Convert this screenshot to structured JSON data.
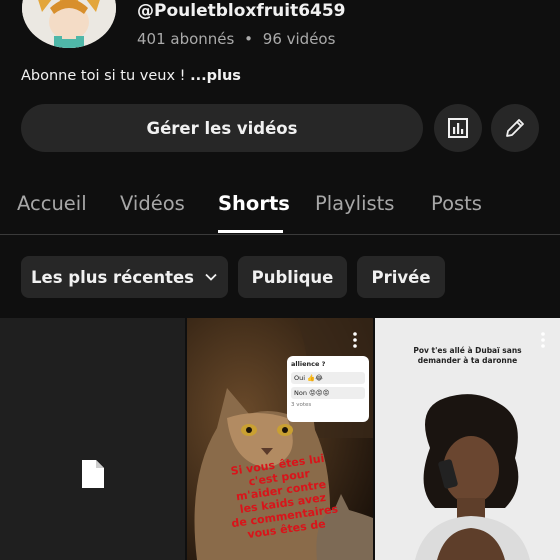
{
  "channel": {
    "handle": "@Pouletbloxfruit6459",
    "subscribers": "401 abonnés",
    "separator": "•",
    "videos": "96 vidéos",
    "bio": "Abonne toi si tu veux !",
    "bio_more": "...plus"
  },
  "actions": {
    "manage_label": "Gérer les vidéos",
    "analytics_icon": "bar-chart-icon",
    "edit_icon": "pencil-icon"
  },
  "tabs": [
    {
      "label": "Accueil",
      "active": false
    },
    {
      "label": "Vidéos",
      "active": false
    },
    {
      "label": "Shorts",
      "active": true
    },
    {
      "label": "Playlists",
      "active": false
    },
    {
      "label": "Posts",
      "active": false
    }
  ],
  "filters": {
    "sort_label": "Les plus récentes",
    "public_label": "Publique",
    "private_label": "Privée"
  },
  "shorts": [
    {
      "kind": "placeholder",
      "icon": "file-icon"
    },
    {
      "kind": "cat",
      "poll_title": "allience ?",
      "poll_options": [
        "Oui 👍😂",
        "Non 😡😡😡"
      ],
      "poll_footer": "3 votes",
      "caption_lines": [
        "Si vous êtes lui",
        "c'est pour",
        "m'aider contre",
        "les kaids avez",
        "de commentaires",
        "vous êtes de"
      ]
    },
    {
      "kind": "dubai",
      "caption_lines": [
        "Pov t'es allé à Dubaï sans",
        "demander à ta daronne"
      ]
    }
  ],
  "colors": {
    "background": "#0f0f0f",
    "button": "#272727",
    "text_primary": "#f1f1f1",
    "text_secondary": "#aaaaaa",
    "caption_red": "#d9141a"
  }
}
